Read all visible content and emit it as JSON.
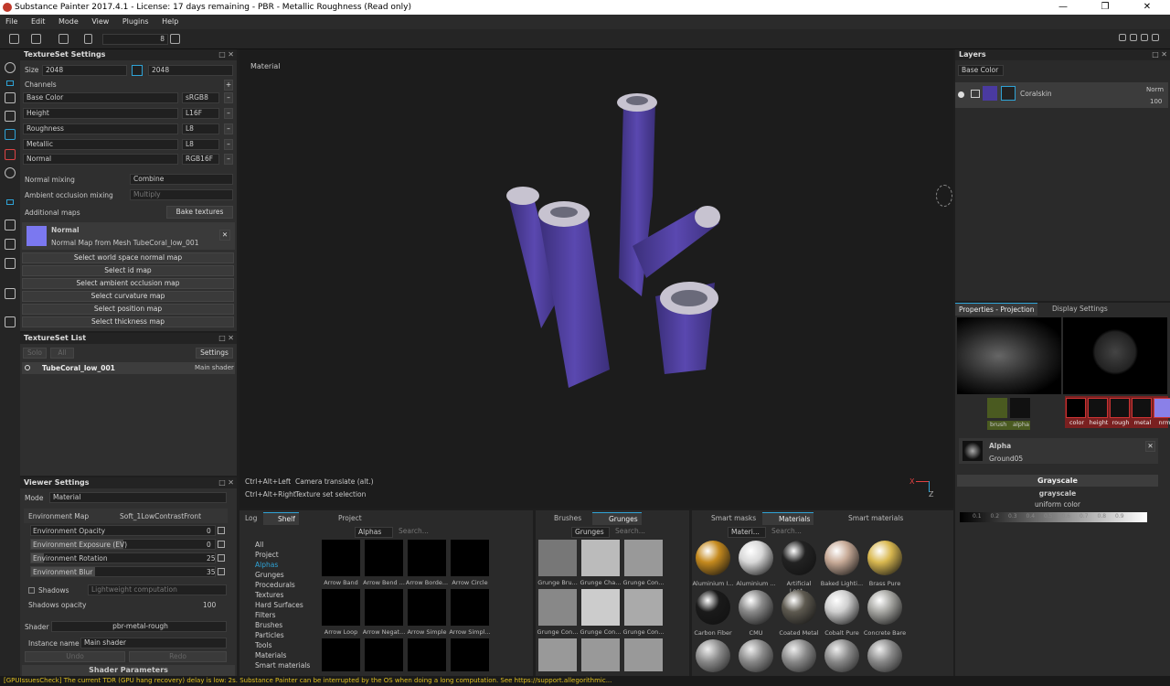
{
  "window": {
    "title": "Substance Painter 2017.4.1 - License: 17 days remaining - PBR - Metallic Roughness (Read only)"
  },
  "menu": [
    "File",
    "Edit",
    "Mode",
    "View",
    "Plugins",
    "Help"
  ],
  "toolbar": {
    "value": "8"
  },
  "textureset_settings": {
    "title": "TextureSet Settings",
    "size_label": "Size",
    "size_value": "2048",
    "size_value2": "2048",
    "channels_label": "Channels",
    "channels": [
      {
        "name": "Base Color",
        "format": "sRGB8"
      },
      {
        "name": "Height",
        "format": "L16F"
      },
      {
        "name": "Roughness",
        "format": "L8"
      },
      {
        "name": "Metallic",
        "format": "L8"
      },
      {
        "name": "Normal",
        "format": "RGB16F"
      }
    ],
    "normal_mixing_label": "Normal mixing",
    "normal_mixing_value": "Combine",
    "ao_mixing_label": "Ambient occlusion mixing",
    "ao_mixing_value": "Multiply",
    "additional_maps_label": "Additional maps",
    "bake_button": "Bake textures",
    "normal_title": "Normal",
    "normal_sub": "Normal Map from Mesh TubeCoral_low_001",
    "select_buttons": [
      "Select world space normal map",
      "Select id map",
      "Select ambient occlusion map",
      "Select curvature map",
      "Select position map",
      "Select thickness map"
    ]
  },
  "textureset_list": {
    "title": "TextureSet List",
    "solo": "Solo",
    "all": "All",
    "settings": "Settings",
    "item": "TubeCoral_low_001",
    "shader": "Main shader"
  },
  "viewer_settings": {
    "title": "Viewer Settings",
    "mode_label": "Mode",
    "mode_value": "Material",
    "env_map_label": "Environment Map",
    "env_map_value": "Soft_1LowContrastFront",
    "sliders": [
      {
        "label": "Environment Opacity",
        "value": "0",
        "fill": 0
      },
      {
        "label": "Environment Exposure (EV)",
        "value": "0",
        "fill": 0.5
      },
      {
        "label": "Environment Rotation",
        "value": "25",
        "fill": 0.07
      },
      {
        "label": "Environment Blur",
        "value": "35",
        "fill": 0.35
      }
    ],
    "shadows_label": "Shadows",
    "shadows_value": "Lightweight computation",
    "shadows_opacity_label": "Shadows opacity",
    "shadows_opacity_value": "100",
    "shader_label": "Shader",
    "shader_value": "pbr-metal-rough",
    "instance_label": "Instance name",
    "instance_value": "Main shader",
    "undo": "Undo",
    "redo": "Redo",
    "shader_params": "Shader Parameters"
  },
  "viewport": {
    "label": "Material",
    "hint1_key": "Ctrl+Alt+Left",
    "hint1_val": "Camera translate (alt.)",
    "hint2_key": "Ctrl+Alt+Right",
    "hint2_val": "Texture set selection",
    "axis_x": "X",
    "axis_z": "Z"
  },
  "layers": {
    "title": "Layers",
    "channel": "Base Color",
    "layer_name": "Coralskin",
    "blend": "Norm",
    "opacity": "100"
  },
  "properties": {
    "tab1": "Properties - Projection",
    "tab2": "Display Settings",
    "slots": [
      "brush",
      "alpha"
    ],
    "channels": [
      "color",
      "height",
      "rough",
      "metal",
      "nrm"
    ],
    "alpha_title": "Alpha",
    "alpha_name": "Ground05",
    "grayscale_header": "Grayscale",
    "grayscale_title": "grayscale",
    "grayscale_sub": "uniform color",
    "ramp_ticks": [
      "0.1",
      "0.2",
      "0.3",
      "0.4",
      "0.5",
      "0.6",
      "0.7",
      "0.8",
      "0.9"
    ]
  },
  "shelf": {
    "tabs": [
      "Log",
      "Shelf",
      "Project"
    ],
    "filter": "Alphas",
    "search_placeholder": "Search...",
    "categories": [
      "All",
      "Project",
      "Alphas",
      "Grunges",
      "Procedurals",
      "Textures",
      "Hard Surfaces",
      "Filters",
      "Brushes",
      "Particles",
      "Tools",
      "Materials",
      "Smart materials"
    ],
    "alphas": [
      "Arrow Band",
      "Arrow Bend ...",
      "Arrow Borde...",
      "Arrow Circle",
      "Arrow Loop",
      "Arrow Negat...",
      "Arrow Simple",
      "Arrow Simpl..."
    ]
  },
  "grunges": {
    "tabs": [
      "Brushes",
      "Grunges"
    ],
    "filter": "Grunges",
    "items": [
      "Grunge Bru...",
      "Grunge Cha...",
      "Grunge Con...",
      "Grunge Con...",
      "Grunge Con...",
      "Grunge Con..."
    ]
  },
  "materials": {
    "tabs": [
      "Smart masks",
      "Materials",
      "Smart materials"
    ],
    "filter": "Materi...",
    "items": [
      {
        "name": "Aluminium I...",
        "color": "#c58a1e"
      },
      {
        "name": "Aluminium ...",
        "color": "#d8d8d8"
      },
      {
        "name": "Artificial Leat...",
        "color": "#222222"
      },
      {
        "name": "Baked Lighti...",
        "color": "#c8ab98"
      },
      {
        "name": "Brass Pure",
        "color": "#d9b850"
      },
      {
        "name": "Carbon Fiber",
        "color": "#1a1a1a"
      },
      {
        "name": "CMU",
        "color": "#8a8a8a"
      },
      {
        "name": "Coated Metal",
        "color": "#5e5a50"
      },
      {
        "name": "Cobalt Pure",
        "color": "#cfcfcf"
      },
      {
        "name": "Concrete Bare",
        "color": "#a8a8a4"
      }
    ]
  },
  "status": "[GPUIssuesCheck] The current TDR (GPU hang recovery) delay is low: 2s. Substance Painter can be interrupted by the OS when doing a long computation. See https://support.allegorithmic..."
}
